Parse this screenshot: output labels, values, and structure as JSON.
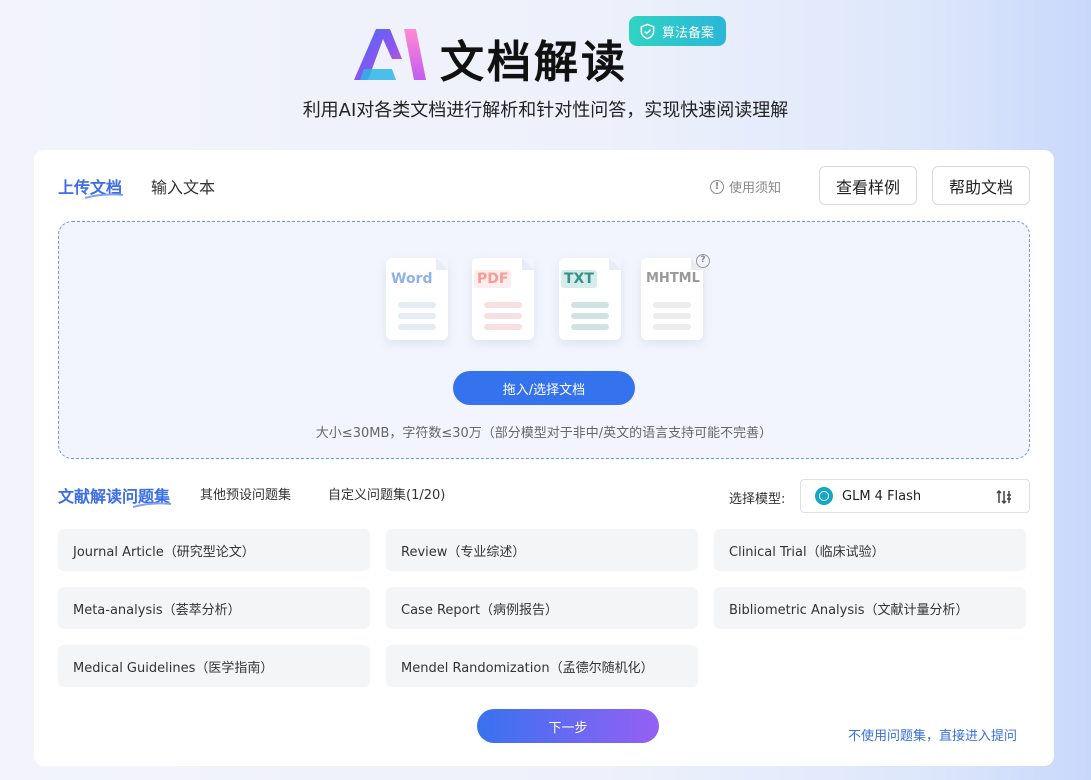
{
  "header": {
    "title": "文档解读",
    "badge": "算法备案",
    "subtitle": "利用AI对各类文档进行解析和针对性问答，实现快速阅读理解"
  },
  "tabs": {
    "upload": "上传文档",
    "input": "输入文本"
  },
  "toolbar": {
    "notice": "使用须知",
    "sample": "查看样例",
    "help": "帮助文档"
  },
  "dropzone": {
    "file_types": [
      "Word",
      "PDF",
      "TXT",
      "MHTML"
    ],
    "button": "拖入/选择文档",
    "tip": "大小≤30MB，字符数≤30万（部分模型对于非中/英文的语言支持可能不完善）"
  },
  "question_tabs": {
    "main": "文献解读问题集",
    "preset": "其他预设问题集",
    "custom": "自定义问题集(1/20)"
  },
  "model": {
    "label": "选择模型:",
    "value": "GLM 4 Flash"
  },
  "question_sets": [
    "Journal Article（研究型论文）",
    "Review（专业综述）",
    "Clinical Trial（临床试验）",
    "Meta-analysis（荟萃分析）",
    "Case Report（病例报告）",
    "Bibliometric Analysis（文献计量分析）",
    "Medical Guidelines（医学指南）",
    "Mendel Randomization（孟德尔随机化）"
  ],
  "footer": {
    "next": "下一步",
    "skip": "不使用问题集，直接进入提问"
  },
  "colors": {
    "accent": "#3572ee",
    "badge": "#2fd3c2",
    "link": "#3a6fe0"
  }
}
